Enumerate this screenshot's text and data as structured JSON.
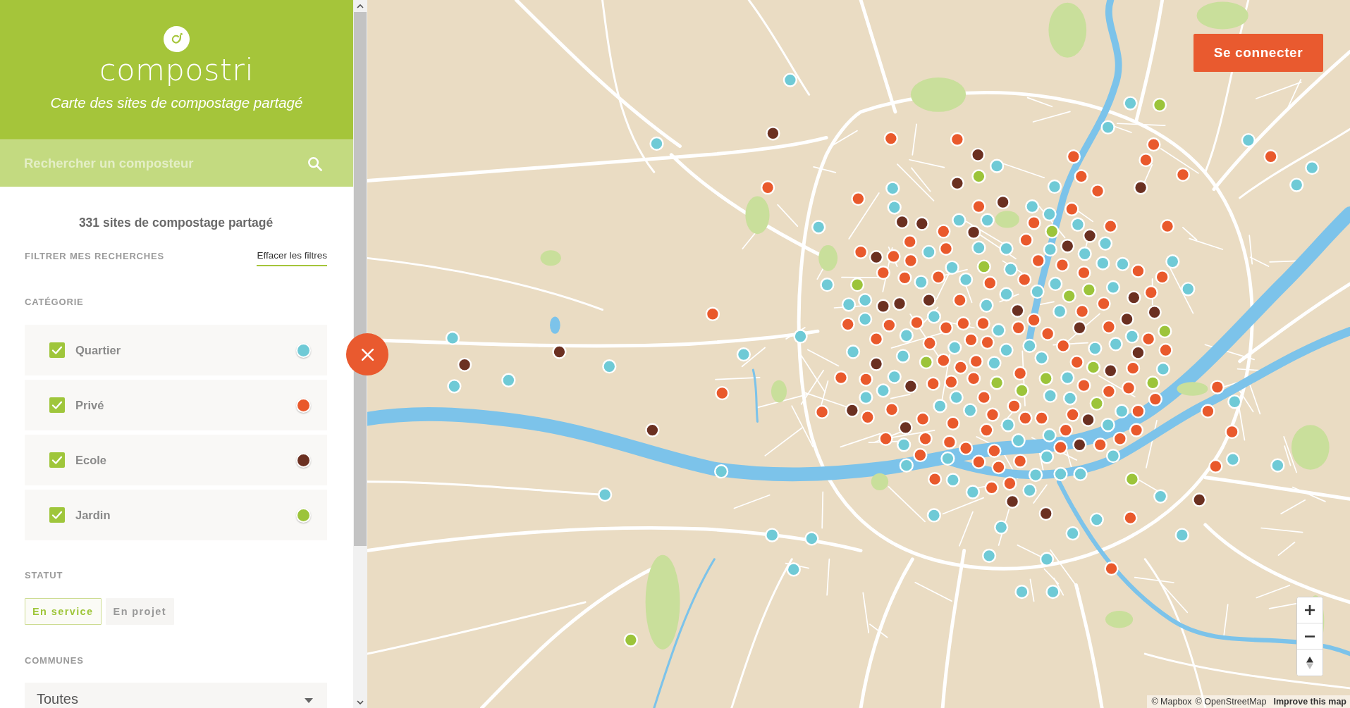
{
  "header": {
    "logo": "compostri",
    "subtitle": "Carte des sites de compostage partagé"
  },
  "search": {
    "placeholder": "Rechercher un composteur"
  },
  "summary": "331 sites de compostage partagé",
  "filters": {
    "title": "FILTRER MES RECHERCHES",
    "clear": "Effacer les filtres"
  },
  "category": {
    "label": "CATÉGORIE",
    "items": [
      {
        "name": "Quartier",
        "checked": true,
        "color": "#6fcad6"
      },
      {
        "name": "Privé",
        "checked": true,
        "color": "#e9592c"
      },
      {
        "name": "Ecole",
        "checked": true,
        "color": "#6b3021"
      },
      {
        "name": "Jardin",
        "checked": true,
        "color": "#9cc43a"
      }
    ]
  },
  "status": {
    "label": "STATUT",
    "options": [
      {
        "label": "En service",
        "selected": true
      },
      {
        "label": "En projet",
        "selected": false
      }
    ]
  },
  "communes": {
    "label": "COMMUNES",
    "value": "Toutes"
  },
  "map": {
    "login_button": "Se connecter",
    "attribution": {
      "links": [
        "© Mapbox",
        "© OpenStreetMap"
      ],
      "improve": "Improve this map"
    }
  }
}
